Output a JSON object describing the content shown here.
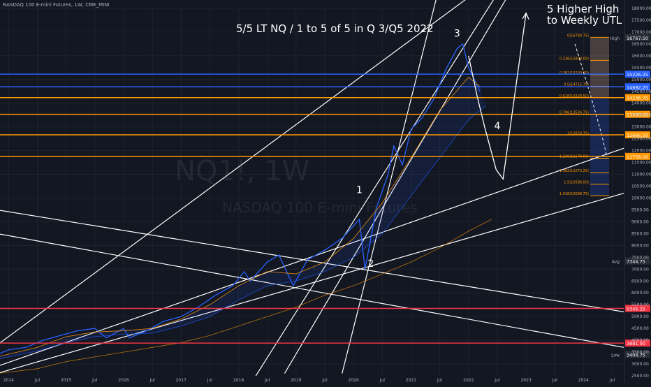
{
  "header": {
    "symbol_line": "NASDAQ 100 E-mini Futures, 1W, CME_MINI"
  },
  "annotations": {
    "title": "5/5 LT NQ / 1 to 5 of 5 in Q 3/Q5 2022",
    "note_line1": "5 Higher High",
    "note_line2": "to Weekly UTL",
    "wave_labels": [
      "1",
      "2",
      "3",
      "4"
    ]
  },
  "watermark": {
    "ticker": "NQ1!, 1W",
    "name": "NASDAQ 100 E-mini Futures"
  },
  "colors": {
    "background": "#131722",
    "price": "#2962ff",
    "channel": "#ffffff",
    "support": "#f23645",
    "fib_line": "#ff9800",
    "blue_level": "#2962ff",
    "avg": "#434651"
  },
  "chart_data": {
    "type": "line",
    "title": "",
    "xlabel": "",
    "ylabel": "",
    "ylim": [
      2500,
      18000
    ],
    "grid": true,
    "x_ticks": [
      "2014",
      "Jul",
      "2015",
      "Jul",
      "2016",
      "Jul",
      "2017",
      "Jul",
      "2018",
      "Jul",
      "2019",
      "Jul",
      "2020",
      "Jul",
      "2021",
      "Jul",
      "2022",
      "Jul",
      "2023",
      "Jul",
      "2024",
      "Jul"
    ],
    "y_ticks": [
      2500,
      3000,
      3500,
      4000,
      4500,
      5000,
      5500,
      6000,
      6500,
      7000,
      7500,
      8000,
      8500,
      9000,
      9500,
      10000,
      10500,
      11000,
      11500,
      12000,
      12500,
      13000,
      13500,
      14000,
      14500,
      15000,
      15500,
      16000,
      16500,
      17000,
      17500,
      18000
    ],
    "series": [
      {
        "x": [
          2013.8,
          2014.0,
          2014.3,
          2014.6,
          2014.9,
          2015.2,
          2015.5,
          2015.7,
          2016.0,
          2016.1,
          2016.4,
          2016.7,
          2017.0,
          2017.3,
          2017.6,
          2017.9,
          2018.1,
          2018.2,
          2018.5,
          2018.7,
          2018.95,
          2019.2,
          2019.5,
          2019.8,
          2020.1,
          2020.2,
          2020.4,
          2020.6,
          2020.7,
          2020.85,
          2021.0,
          2021.2,
          2021.4,
          2021.6,
          2021.8,
          2021.9,
          2022.0,
          2022.2
        ],
        "y": [
          3400,
          3600,
          3700,
          4000,
          4200,
          4400,
          4500,
          4100,
          4500,
          4100,
          4400,
          4800,
          5000,
          5400,
          5900,
          6300,
          6900,
          6500,
          7300,
          7600,
          6300,
          7400,
          7800,
          8300,
          9100,
          7000,
          9600,
          11000,
          12200,
          11400,
          12900,
          13400,
          14200,
          15400,
          16300,
          16500,
          15500,
          14500
        ],
        "weight": 1
      },
      {
        "x": [
          2013.8,
          2014.5,
          2015.0,
          2015.5,
          2016.0,
          2016.5,
          2017.0,
          2017.5,
          2018.0,
          2018.5,
          2019.0,
          2019.5,
          2020.0,
          2020.5,
          2021.0,
          2021.5,
          2022.0,
          2022.2
        ],
        "y": [
          3300,
          3700,
          4150,
          4350,
          4400,
          4500,
          4900,
          5500,
          6300,
          6900,
          6800,
          7300,
          8300,
          9800,
          11700,
          13700,
          15100,
          14700
        ],
        "weight": 0.8
      },
      {
        "x": [
          2013.8,
          2014.5,
          2015.0,
          2015.5,
          2016.0,
          2016.5,
          2017.0,
          2017.5,
          2018.0,
          2018.5,
          2019.0,
          2019.5,
          2020.0,
          2020.5,
          2021.0,
          2021.5,
          2022.0,
          2022.3
        ],
        "y": [
          3200,
          3550,
          3900,
          4150,
          4250,
          4300,
          4600,
          5000,
          5700,
          6300,
          6500,
          6900,
          7500,
          8500,
          10100,
          11700,
          13300,
          13900
        ],
        "weight": 0.6
      },
      {
        "x": [
          2013.8,
          2014.5,
          2015.0,
          2015.5,
          2016.0,
          2016.5,
          2017.0,
          2017.5,
          2018.0,
          2018.5,
          2019.0,
          2019.5,
          2020.0,
          2020.5,
          2021.0,
          2021.5,
          2022.0,
          2022.4
        ],
        "y": [
          2600,
          2800,
          3100,
          3300,
          3500,
          3700,
          3900,
          4200,
          4600,
          5000,
          5400,
          5900,
          6300,
          6800,
          7300,
          7900,
          8600,
          9100
        ],
        "weight": 0.5
      }
    ],
    "projection": {
      "x": [
        2022.0,
        2022.15,
        2022.28,
        2022.48,
        2022.6,
        2023.0
      ],
      "y": [
        16000,
        14300,
        13000,
        11200,
        10800,
        17800
      ],
      "wave_label_positions": [
        {
          "label": "1",
          "x": 2020.1,
          "y": 10200
        },
        {
          "label": "2",
          "x": 2020.3,
          "y": 7100
        },
        {
          "label": "3",
          "x": 2021.8,
          "y": 16800
        },
        {
          "label": "4",
          "x": 2022.5,
          "y": 12900
        }
      ]
    },
    "trendlines": [
      {
        "x": [
          2013.8,
          2022.3
        ],
        "y": [
          3800,
          19000
        ]
      },
      {
        "x": [
          2013.8,
          2024.7
        ],
        "y": [
          2900,
          12100
        ]
      },
      {
        "x": [
          2013.8,
          2024.7
        ],
        "y": [
          2600,
          10200
        ]
      },
      {
        "x": [
          2013.8,
          2024.7
        ],
        "y": [
          9500,
          5200
        ]
      },
      {
        "x": [
          2013.8,
          2024.7
        ],
        "y": [
          8500,
          3700
        ]
      },
      {
        "x": [
          2018.3,
          2022.6
        ],
        "y": [
          2500,
          19000
        ]
      },
      {
        "x": [
          2018.8,
          2022.8
        ],
        "y": [
          2600,
          19000
        ]
      },
      {
        "x": [
          2019.8,
          2021.5
        ],
        "y": [
          2600,
          19000
        ]
      }
    ],
    "horizontal_levels": [
      {
        "value": 15226.25,
        "label": "15226.25",
        "color": "#2962ff"
      },
      {
        "value": 14692.25,
        "label": "14692.25",
        "color": "#2962ff"
      },
      {
        "value": 14236.75,
        "label": "14236.75",
        "color": "#ff9800"
      },
      {
        "value": 13530.25,
        "label": "13530.25",
        "color": "#ff9800"
      },
      {
        "value": 12666.5,
        "label": "12666.50",
        "color": "#ff9800"
      },
      {
        "value": 11758.0,
        "label": "11758.00",
        "color": "#ff9800"
      },
      {
        "value": 5345.25,
        "label": "5345.25",
        "color": "#f23645"
      },
      {
        "value": 3881.0,
        "label": "3881.00",
        "color": "#f23645"
      }
    ],
    "fib_levels": [
      {
        "ratio": "0",
        "value": 16780.75,
        "label": "0(16780.75)"
      },
      {
        "ratio": "0.236",
        "value": 15808.0,
        "label": "0.236(15808.00)"
      },
      {
        "ratio": "0.382",
        "value": 15203.0,
        "label": "0.382(15203.00)"
      },
      {
        "ratio": "0.5",
        "value": 14715.75,
        "label": "0.5(14715.75)"
      },
      {
        "ratio": "0.618",
        "value": 14228.5,
        "label": "0.618(14228.50)"
      },
      {
        "ratio": "0.786",
        "value": 13534.75,
        "label": "0.786(13534.75)"
      },
      {
        "ratio": "1",
        "value": 12650.75,
        "label": "1(12650.75)"
      },
      {
        "ratio": "1.236",
        "value": 11678.0,
        "label": "1.236(11678.00)"
      },
      {
        "ratio": "1.382",
        "value": 11073.25,
        "label": "1.382(11073.25)"
      },
      {
        "ratio": "1.5",
        "value": 10586.0,
        "label": "1.5(10586.00)"
      },
      {
        "ratio": "1.618",
        "value": 10098.75,
        "label": "1.618(10098.75)"
      }
    ],
    "price_tags": [
      {
        "label": "High",
        "value": 16767.5,
        "text": "16767.50"
      },
      {
        "label": "Avg",
        "value": 7344.75,
        "text": "7344.75"
      },
      {
        "label": "Low",
        "value": 3404.75,
        "text": "3404.75"
      }
    ]
  }
}
